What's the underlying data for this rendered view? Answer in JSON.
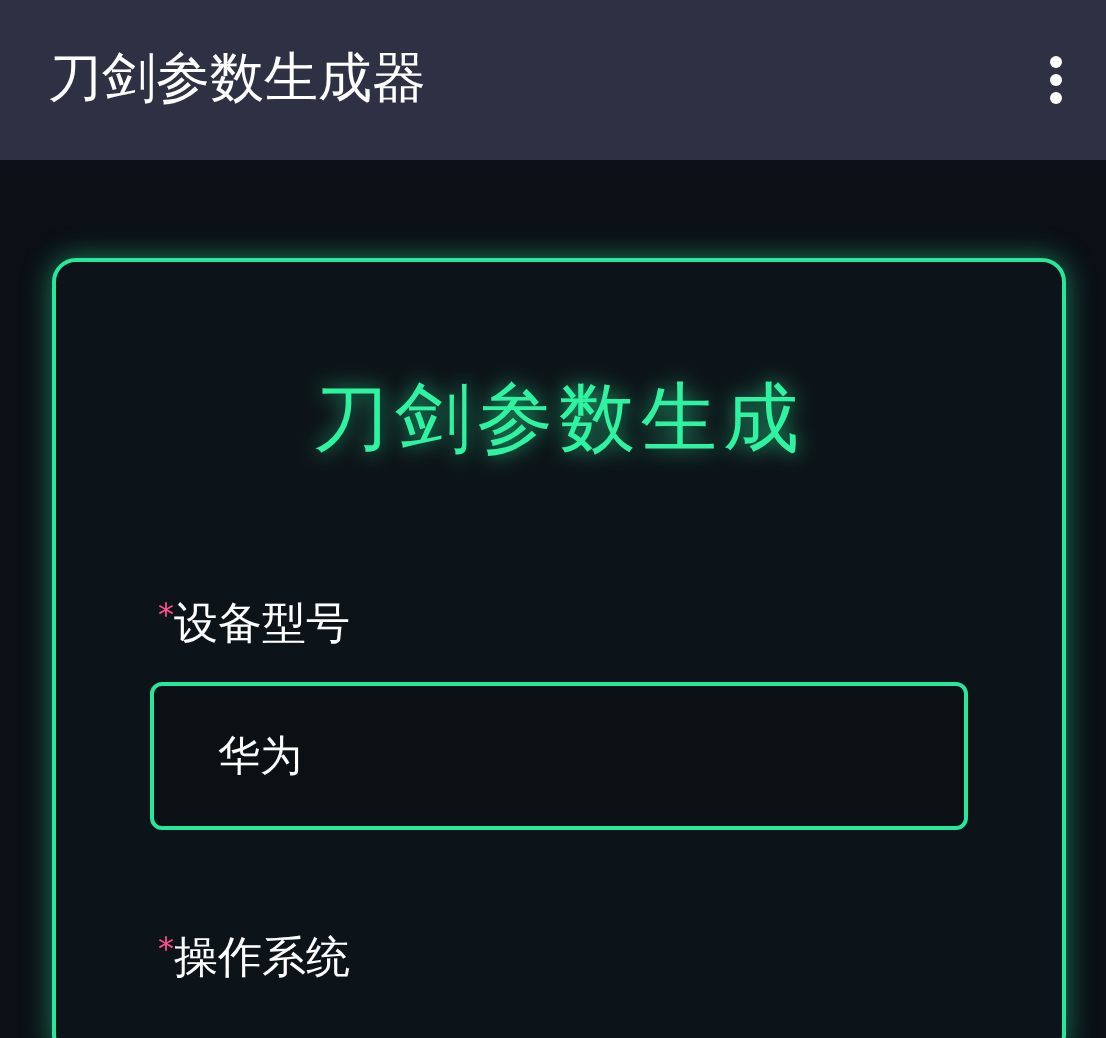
{
  "app_bar": {
    "title": "刀剑参数生成器"
  },
  "form": {
    "heading": "刀剑参数生成",
    "fields": [
      {
        "required_mark": "*",
        "label": "设备型号",
        "value": "华为",
        "kind": "input"
      },
      {
        "required_mark": "*",
        "label": "操作系统",
        "kind": "label_only"
      }
    ]
  }
}
